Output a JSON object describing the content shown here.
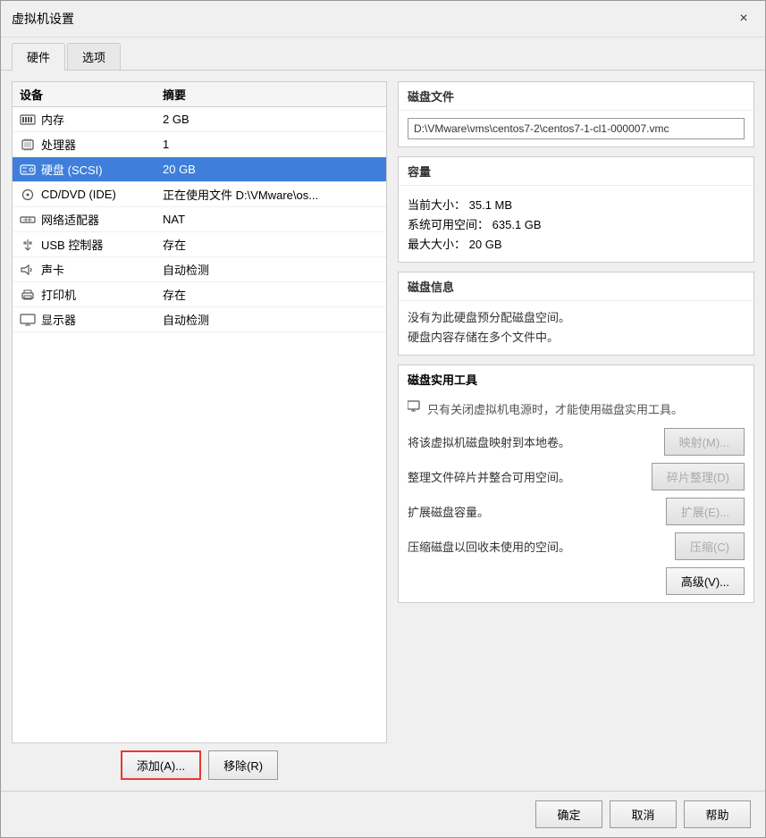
{
  "window": {
    "title": "虚拟机设置",
    "close_label": "×"
  },
  "tabs": [
    {
      "id": "hardware",
      "label": "硬件",
      "active": true
    },
    {
      "id": "options",
      "label": "选项",
      "active": false
    }
  ],
  "device_table": {
    "col_device": "设备",
    "col_summary": "摘要",
    "rows": [
      {
        "icon": "💾",
        "device": "内存",
        "summary": "2 GB",
        "selected": false
      },
      {
        "icon": "⚙",
        "device": "处理器",
        "summary": "1",
        "selected": false
      },
      {
        "icon": "🖴",
        "device": "硬盘 (SCSI)",
        "summary": "20 GB",
        "selected": true
      },
      {
        "icon": "💿",
        "device": "CD/DVD (IDE)",
        "summary": "正在使用文件 D:\\VMware\\os...",
        "selected": false
      },
      {
        "icon": "🌐",
        "device": "网络适配器",
        "summary": "NAT",
        "selected": false
      },
      {
        "icon": "🔌",
        "device": "USB 控制器",
        "summary": "存在",
        "selected": false
      },
      {
        "icon": "🔊",
        "device": "声卡",
        "summary": "自动检测",
        "selected": false
      },
      {
        "icon": "🖨",
        "device": "打印机",
        "summary": "存在",
        "selected": false
      },
      {
        "icon": "🖥",
        "device": "显示器",
        "summary": "自动检测",
        "selected": false
      }
    ]
  },
  "bottom_buttons": {
    "add": "添加(A)...",
    "remove": "移除(R)"
  },
  "disk_file": {
    "section_title": "磁盘文件",
    "value": "D:\\VMware\\vms\\centos7-2\\centos7-1-cl1-000007.vmc"
  },
  "capacity": {
    "section_title": "容量",
    "current_size_label": "当前大小：",
    "current_size_value": "35.1 MB",
    "system_free_label": "系统可用空间：",
    "system_free_value": "635.1 GB",
    "max_size_label": "最大大小：",
    "max_size_value": "20 GB"
  },
  "disk_info": {
    "section_title": "磁盘信息",
    "line1": "没有为此硬盘预分配磁盘空间。",
    "line2": "硬盘内容存储在多个文件中。"
  },
  "disk_utility": {
    "section_title": "磁盘实用工具",
    "note": "只有关闭虚拟机电源时，才能使用磁盘实用工具。",
    "map_label": "将该虚拟机磁盘映射到本地卷。",
    "map_btn": "映射(M)...",
    "defrag_label": "整理文件碎片并整合可用空间。",
    "defrag_btn": "碎片整理(D)",
    "expand_label": "扩展磁盘容量。",
    "expand_btn": "扩展(E)...",
    "compress_label": "压缩磁盘以回收未使用的空间。",
    "compress_btn": "压缩(C)",
    "advanced_btn": "高级(V)..."
  },
  "footer": {
    "ok": "确定",
    "cancel": "取消",
    "help": "帮助"
  }
}
